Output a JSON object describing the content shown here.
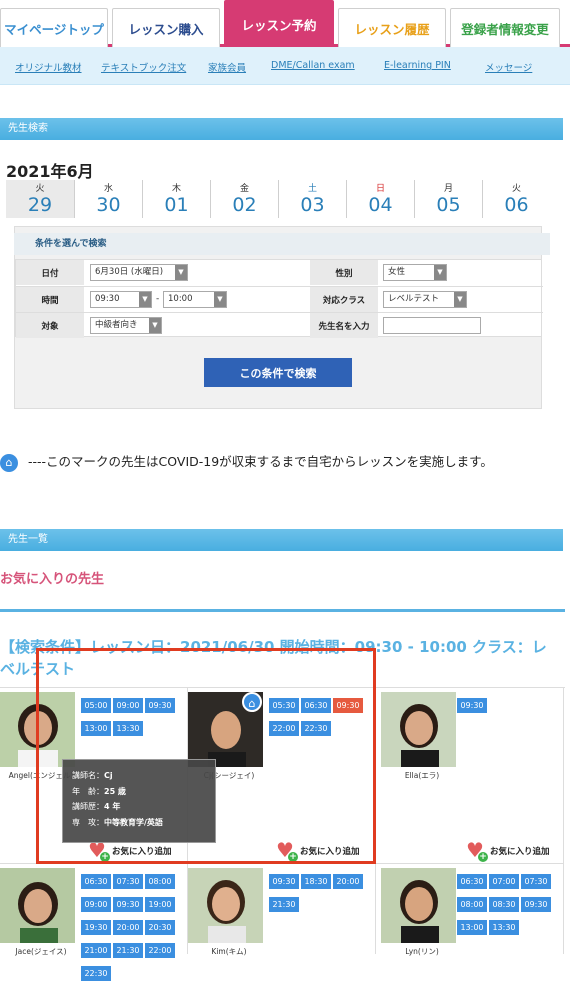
{
  "tabs": [
    {
      "label": "マイページトップ",
      "color": "#3a8fd0"
    },
    {
      "label": "レッスン購入",
      "color": "#2d4d8f"
    },
    {
      "label": "レッスン予約",
      "color": "#ffffff"
    },
    {
      "label": "レッスン履歴",
      "color": "#e8a019"
    },
    {
      "label": "登録者情報変更",
      "color": "#3aa24a"
    }
  ],
  "subnav": [
    "オリジナル教材",
    "テキストブック注文",
    "家族会員",
    "DME/Callan exam",
    "E-learning PIN",
    "メッセージ"
  ],
  "search_section_title": "先生検索",
  "calendar": {
    "month": "2021年6月",
    "days": [
      {
        "weekday": "火",
        "date": "29"
      },
      {
        "weekday": "水",
        "date": "30"
      },
      {
        "weekday": "木",
        "date": "01"
      },
      {
        "weekday": "金",
        "date": "02"
      },
      {
        "weekday": "土",
        "date": "03"
      },
      {
        "weekday": "日",
        "date": "04"
      },
      {
        "weekday": "月",
        "date": "05"
      },
      {
        "weekday": "火",
        "date": "06"
      }
    ]
  },
  "conditions": {
    "title": "条件を選んで検索",
    "date_label": "日付",
    "date_value": "6月30日 (水曜日)",
    "gender_label": "性別",
    "gender_value": "女性",
    "time_label": "時間",
    "time_from": "09:30",
    "time_to": "10:00",
    "time_sep": "-",
    "class_label": "対応クラス",
    "class_value": "レベルテスト",
    "target_label": "対象",
    "target_value": "中級者向き",
    "name_label": "先生名を入力",
    "name_value": "",
    "search_button": "この条件で検索"
  },
  "notice": "----このマークの先生はCOVID-19が収束するまで自宅からレッスンを実施します。",
  "list_section_title": "先生一覧",
  "favorites_heading": "お気に入りの先生",
  "result_condition": "【検索条件】レッスン日：2021/06/30 開始時間：09:30 - 10:00 クラス：レベルテスト",
  "teachers": [
    {
      "name": "Angel(エンジェル)",
      "slots": [
        "05:00",
        "09:00",
        "09:30",
        "13:00",
        "13:30"
      ],
      "red": [],
      "home": false,
      "fav": "お気に入り追加"
    },
    {
      "name": "Cj(シージェイ)",
      "slots": [
        "05:30",
        "06:30",
        "09:30",
        "22:00",
        "22:30"
      ],
      "red": [
        "09:30"
      ],
      "home": true,
      "fav": "お気に入り追加"
    },
    {
      "name": "Ella(エラ)",
      "slots": [
        "09:30"
      ],
      "red": [],
      "home": false,
      "fav": "お気に入り追加"
    },
    {
      "name": "Jace(ジェイス)",
      "slots": [
        "06:30",
        "07:30",
        "08:00",
        "09:00",
        "09:30",
        "19:00",
        "19:30",
        "20:00",
        "20:30",
        "21:00",
        "21:30",
        "22:00",
        "22:30"
      ],
      "red": [],
      "home": false,
      "fav": ""
    },
    {
      "name": "Kim(キム)",
      "slots": [
        "09:30",
        "18:30",
        "20:00",
        "21:30"
      ],
      "red": [],
      "home": false,
      "fav": ""
    },
    {
      "name": "Lyn(リン)",
      "slots": [
        "06:30",
        "07:00",
        "07:30",
        "08:00",
        "08:30",
        "09:30",
        "13:00",
        "13:30"
      ],
      "red": [],
      "home": false,
      "fav": ""
    }
  ],
  "tooltip": {
    "name_label": "講師名：",
    "name": "Cj",
    "age_label": "年　齢：",
    "age": "25 歳",
    "career_label": "講師歴：",
    "career": "4 年",
    "major_label": "専　攻：",
    "major": "中等教育学/英語"
  },
  "colors": {
    "accent": "#d63b73",
    "blue": "#3b8fe0",
    "highlight_box": "#e03b20"
  }
}
